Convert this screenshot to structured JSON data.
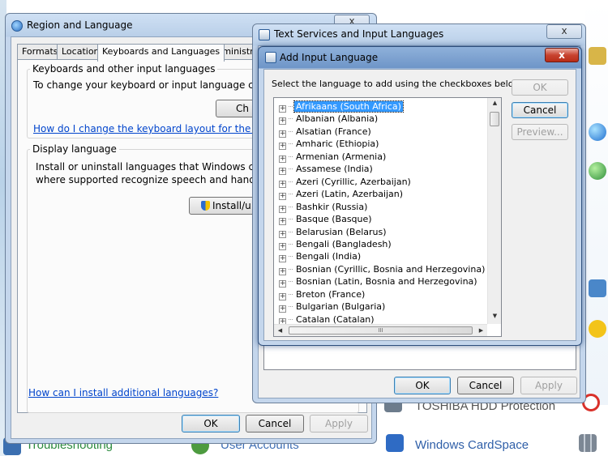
{
  "background": {
    "items": [
      {
        "label": "Troubleshooting",
        "color": "#2b8a3e"
      },
      {
        "label": "User Accounts",
        "color": "#3f6fb5"
      },
      {
        "label": "Windows CardSpace",
        "color": "#2f5fa8"
      },
      {
        "label": "TOSHIBA HDD Protection",
        "color": "#555555"
      }
    ]
  },
  "region_window": {
    "title": "Region and Language",
    "close": "x",
    "tabs": [
      "Formats",
      "Location",
      "Keyboards and Languages",
      "Administrati"
    ],
    "keyboards_group": {
      "legend": "Keyboards and other input languages",
      "text": "To change your keyboard or input language click Ch",
      "button": "Ch",
      "link": "How do I change the keyboard layout for the Welco"
    },
    "display_group": {
      "legend": "Display language",
      "text1": "Install or uninstall languages that Windows can use f",
      "text2": "where supported recognize speech and handwriting",
      "button": "Install/u"
    },
    "install_link": "How can I install additional languages?",
    "ok": "OK",
    "cancel": "Cancel",
    "apply": "Apply"
  },
  "text_services_window": {
    "title": "Text Services and Input Languages",
    "close": "x",
    "ok": "OK",
    "cancel": "Cancel",
    "apply": "Apply"
  },
  "add_language_dialog": {
    "title": "Add Input Language",
    "close": "x",
    "instruction": "Select the language to add using the checkboxes below.",
    "ok": "OK",
    "cancel": "Cancel",
    "preview": "Preview...",
    "hscroll_thumb": "III",
    "languages": [
      "Afrikaans (South Africa)",
      "Albanian (Albania)",
      "Alsatian (France)",
      "Amharic (Ethiopia)",
      "Armenian (Armenia)",
      "Assamese (India)",
      "Azeri (Cyrillic, Azerbaijan)",
      "Azeri (Latin, Azerbaijan)",
      "Bashkir (Russia)",
      "Basque (Basque)",
      "Belarusian (Belarus)",
      "Bengali (Bangladesh)",
      "Bengali (India)",
      "Bosnian (Cyrillic, Bosnia and Herzegovina)",
      "Bosnian (Latin, Bosnia and Herzegovina)",
      "Breton (France)",
      "Bulgarian (Bulgaria)",
      "Catalan (Catalan)"
    ],
    "selected_index": 0
  }
}
